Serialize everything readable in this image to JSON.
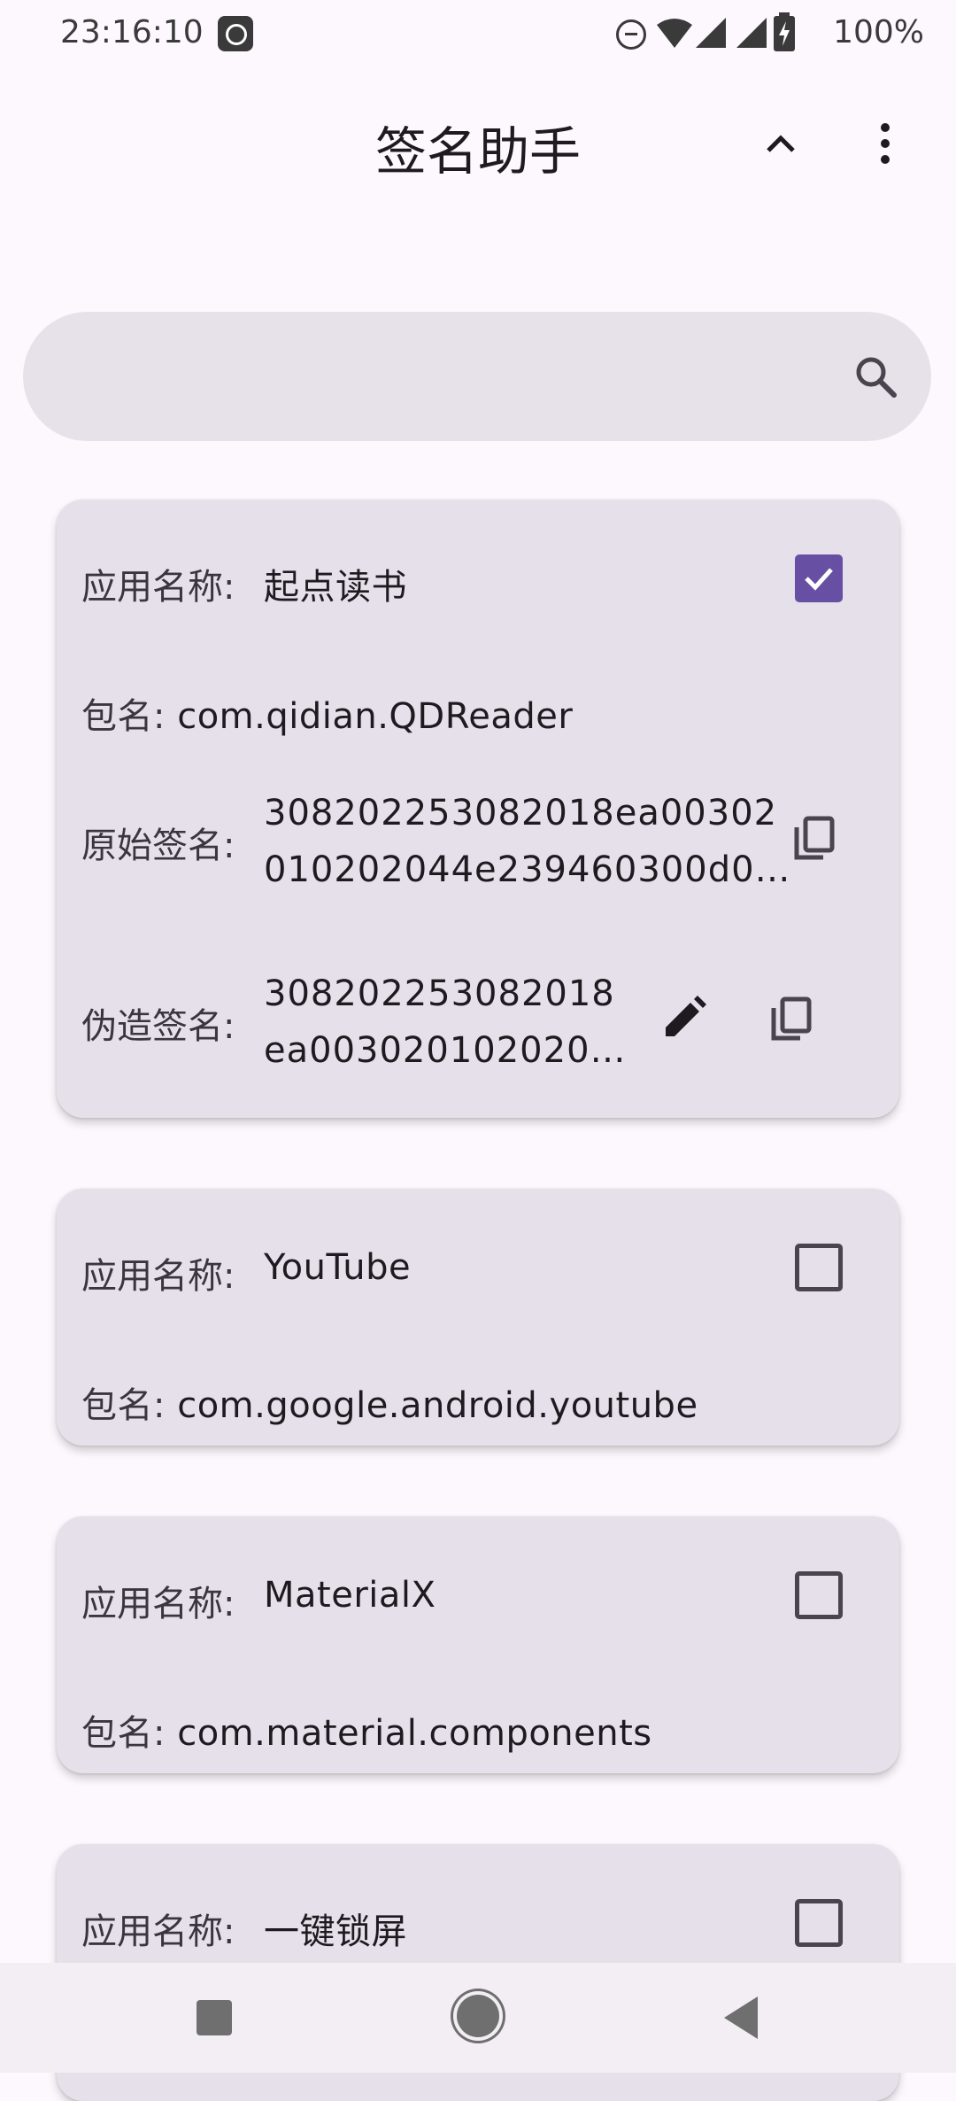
{
  "status_bar": {
    "time": "23:16:10",
    "battery": "100%"
  },
  "app_bar": {
    "title": "签名助手"
  },
  "search": {
    "placeholder": ""
  },
  "labels": {
    "app_name": "应用名称:",
    "package": "包名:",
    "original_signature": "原始签名:",
    "fake_signature": "伪造签名:"
  },
  "apps": [
    {
      "name": "起点读书",
      "package": "com.qidian.QDReader",
      "checked": true,
      "original_signature": [
        "308202253082018ea00302",
        "010202044e239460300d0…"
      ],
      "fake_signature": [
        "308202253082018",
        "ea003020102020…"
      ]
    },
    {
      "name": "YouTube",
      "package": "com.google.android.youtube",
      "checked": false
    },
    {
      "name": "MaterialX",
      "package": "com.material.components",
      "checked": false
    },
    {
      "name": "一键锁屏",
      "checked": false
    }
  ],
  "colors": {
    "accent": "#6750a4",
    "card": "#e6e0ea",
    "search": "#e7e1ea",
    "background": "#fdf8fd"
  },
  "icons": [
    "app-notification-icon",
    "dnd-icon",
    "wifi-icon",
    "signal-icon",
    "battery-icon",
    "collapse-icon",
    "more-vert-icon",
    "search-icon",
    "copy-icon",
    "edit-icon",
    "checkbox-icon",
    "nav-recent-icon",
    "nav-home-icon",
    "nav-back-icon"
  ]
}
